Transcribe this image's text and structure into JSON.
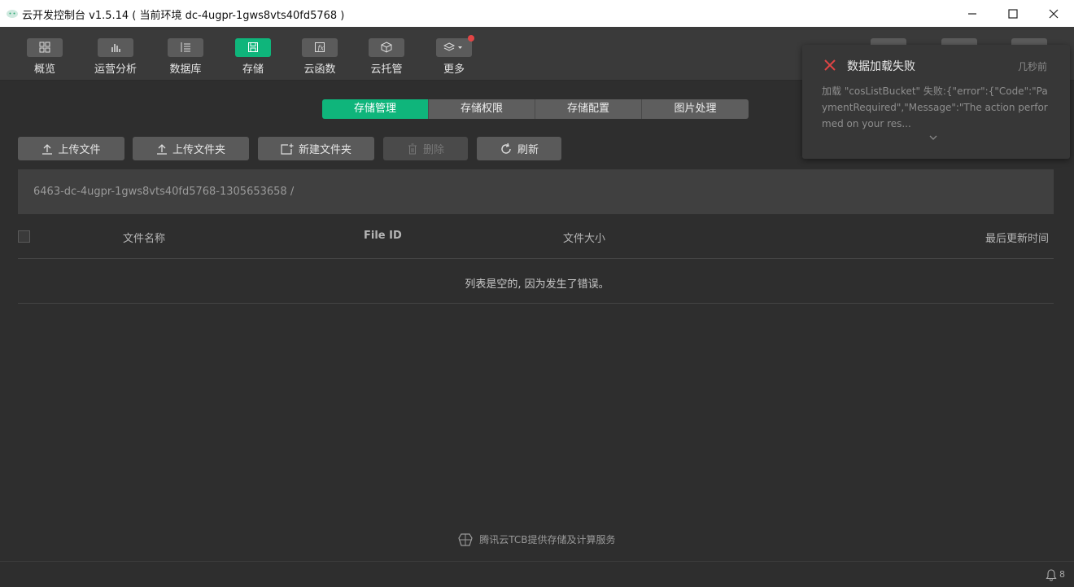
{
  "window": {
    "title": "云开发控制台 v1.5.14 ( 当前环境 dc-4ugpr-1gws8vts40fd5768 )"
  },
  "nav": {
    "items": [
      {
        "label": "概览",
        "icon": "grid-icon"
      },
      {
        "label": "运营分析",
        "icon": "bar-chart-icon"
      },
      {
        "label": "数据库",
        "icon": "database-icon"
      },
      {
        "label": "存储",
        "icon": "save-icon"
      },
      {
        "label": "云函数",
        "icon": "function-icon"
      },
      {
        "label": "云托管",
        "icon": "cube-icon"
      },
      {
        "label": "更多",
        "icon": "layers-icon"
      }
    ],
    "active": "存储"
  },
  "tabs": {
    "items": [
      "存储管理",
      "存储权限",
      "存储配置",
      "图片处理"
    ],
    "active": "存储管理"
  },
  "actions": {
    "upload_file": "上传文件",
    "upload_folder": "上传文件夹",
    "new_folder": "新建文件夹",
    "delete": "删除",
    "refresh": "刷新"
  },
  "path": "6463-dc-4ugpr-1gws8vts40fd5768-1305653658 /",
  "table": {
    "headers": [
      "文件名称",
      "File ID",
      "文件大小",
      "最后更新时间"
    ],
    "empty_message": "列表是空的, 因为发生了错误。"
  },
  "footer": {
    "text": "腾讯云TCB提供存储及计算服务"
  },
  "status": {
    "notification_count": "8"
  },
  "toast": {
    "title": "数据加载失败",
    "time": "几秒前",
    "message": "加载 \"cosListBucket\" 失败:{\"error\":{\"Code\":\"PaymentRequired\",\"Message\":\"The action performed on your res..."
  },
  "colors": {
    "accent": "#0fb57b",
    "error": "#e24545",
    "background": "#2e2e2e"
  }
}
